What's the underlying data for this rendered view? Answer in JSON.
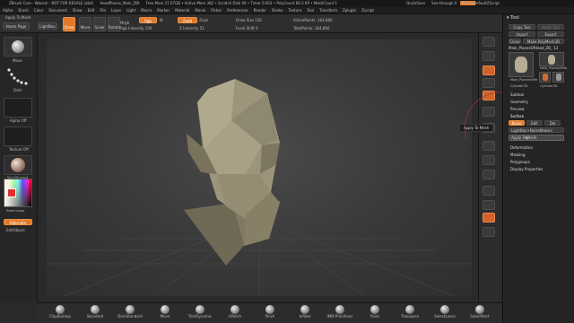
{
  "titlebar": {
    "app": "ZBrush Core - Wacom - NOT FOR RESALE (ab4)",
    "file": "HeadPlanes_Male_ZBt",
    "stats": "Free Mem 27.07GB • Active Mem 382 • Scratch Disk 49 • Timer 0.002 • PolyCount 66.2 KP • MeshCount 1",
    "quicksave": "QuickSave",
    "see_through": "See-through 0",
    "menus_label": "Menus",
    "script_label": "DefaultZScript"
  },
  "menubar": {
    "items": [
      "Alpha",
      "Brush",
      "Color",
      "Document",
      "Draw",
      "Edit",
      "File",
      "Layer",
      "Light",
      "Macro",
      "Marker",
      "Material",
      "Movie",
      "Picker",
      "Preferences",
      "Render",
      "Stroke",
      "Texture",
      "Tool",
      "Transform",
      "Zplugin",
      "Zscript"
    ]
  },
  "palettebar": {
    "apply_to_mesh": "Apply To Mesh",
    "draw_label": "Draw",
    "move_label": "Move",
    "scale_label": "Scale",
    "rotate_label": "Rotate",
    "mrgb": "Mrgb",
    "rgb": "Rgb",
    "m": "M",
    "rgb_intensity": "Rgb Intensity 100",
    "zadd": "Zadd",
    "zsub": "Zsub",
    "z_intensity": "Z Intensity 51",
    "draw_size": "Draw Size 126",
    "focal_shift": "Focal Shift 0",
    "active_points": "ActivePoints: 164,866",
    "total_points": "TotalPoints: 164,866"
  },
  "lefttray": {
    "home_page": "Home Page",
    "lightbox": "LightBox",
    "brush_label": "Move",
    "stroke_label": "Dots",
    "alpha_label": "Alpha Off",
    "texture_label": "Texture Off",
    "material_label": "SkinShade4",
    "gradient_label": "Gradient",
    "switch_color": "SwitchColor",
    "alternate": "Alternate",
    "edit_object": "EditObject"
  },
  "shelf": {
    "items": [
      "ClayBuildup",
      "Standard",
      "DamStandard",
      "Move",
      "TrimDynamic",
      "hPolish",
      "Pinch",
      "Inflate",
      "IMM Primitives",
      "Paint",
      "Transpose",
      "SelectLasso",
      "SelectRect"
    ]
  },
  "rightshelf": {
    "tooltip": "Apply To Mesh"
  },
  "tool": {
    "title": "Tool",
    "copy_tool": "Copy Tool",
    "paste_tool": "Paste Tool",
    "import": "Import",
    "export": "Export",
    "clone": "Clone",
    "make_polymesh": "Make PolyMesh3D",
    "current_tool": "Male_PlanesOfHead_ZB_ 12",
    "thumb1": "Male_PlanesOfHe",
    "thumb2": "Male_PlanesOfHe",
    "thumb3": "Cylinder3D",
    "thumb4": "Cylinder3D",
    "subtool": "Subtool",
    "geometry": "Geometry",
    "preview": "Preview",
    "surface": "Surface",
    "tabs": [
      "Noise",
      "Edit",
      "Del"
    ],
    "lightbox_noise": "LightBox>NoiseMakers",
    "apply_to_mesh": "Apply To Mesh",
    "deformation": "Deformation",
    "masking": "Masking",
    "polygroups": "Polygroups",
    "display_properties": "Display Properties"
  },
  "colors": {
    "accent": "#e0792a",
    "background": "#2a2a2a",
    "canvas": "#3d3d3d"
  }
}
